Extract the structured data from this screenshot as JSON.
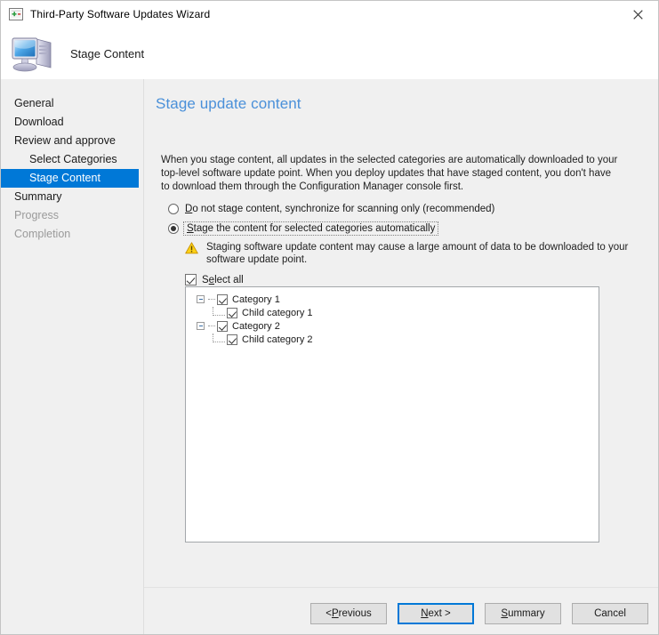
{
  "window": {
    "title": "Third-Party Software Updates Wizard",
    "close_label": "✕",
    "title_icon": "wizard-icon"
  },
  "header": {
    "title": "Stage Content",
    "icon": "computer-icon"
  },
  "sidebar": {
    "items": [
      {
        "label": "General",
        "level": 0,
        "state": "normal"
      },
      {
        "label": "Download",
        "level": 0,
        "state": "normal"
      },
      {
        "label": "Review and approve",
        "level": 0,
        "state": "normal"
      },
      {
        "label": "Select Categories",
        "level": 1,
        "state": "normal"
      },
      {
        "label": "Stage Content",
        "level": 1,
        "state": "active"
      },
      {
        "label": "Summary",
        "level": 0,
        "state": "normal"
      },
      {
        "label": "Progress",
        "level": 0,
        "state": "dim"
      },
      {
        "label": "Completion",
        "level": 0,
        "state": "dim"
      }
    ]
  },
  "main": {
    "page_title": "Stage update content",
    "intro": "When you stage content, all updates in the selected categories are automatically downloaded to your top-level software update point. When you deploy updates that have staged content, you don't have to download them through the Configuration Manager console first.",
    "radio_options": [
      {
        "label_pre": "",
        "accel": "D",
        "label_post": "o not stage content, synchronize for scanning only (recommended)",
        "selected": false,
        "focused": false
      },
      {
        "label_pre": "",
        "accel": "S",
        "label_post": "tage the content for selected categories automatically",
        "selected": true,
        "focused": true
      }
    ],
    "warning": {
      "icon": "warning-triangle-icon",
      "text": "Staging software update content may cause a large amount of data to be downloaded to your software update point."
    },
    "select_all": {
      "label_pre": "S",
      "accel": "e",
      "label_post": "lect all",
      "checked": true
    },
    "tree": [
      {
        "label": "Category 1",
        "checked": true,
        "expanded": true,
        "children": [
          {
            "label": "Child category 1",
            "checked": true
          }
        ]
      },
      {
        "label": "Category 2",
        "checked": true,
        "expanded": true,
        "children": [
          {
            "label": "Child category 2",
            "checked": true
          }
        ]
      }
    ]
  },
  "footer": {
    "buttons": [
      {
        "label_pre": "< ",
        "accel": "P",
        "label_post": "revious",
        "default": false,
        "name": "previous-button"
      },
      {
        "label_pre": "",
        "accel": "N",
        "label_post": "ext >",
        "default": true,
        "name": "next-button"
      },
      {
        "label_pre": "",
        "accel": "S",
        "label_post": "ummary",
        "default": false,
        "name": "summary-button"
      },
      {
        "label_pre": "",
        "accel": "",
        "label_post": "Cancel",
        "default": false,
        "name": "cancel-button"
      }
    ]
  },
  "colors": {
    "accent": "#0078d7",
    "title_blue": "#4a90d9",
    "warning": "#e8a317",
    "window_bg": "#f0f0f0"
  }
}
